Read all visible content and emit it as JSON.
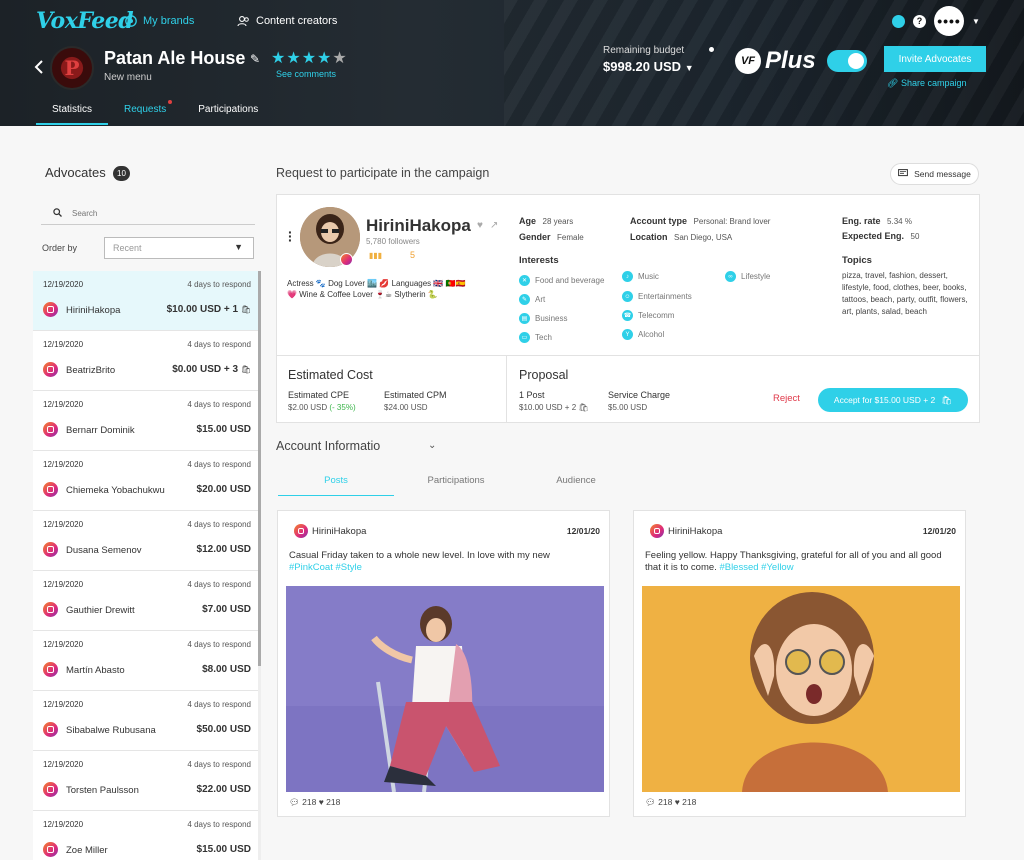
{
  "header": {
    "logo": "VoxFeed",
    "nav": [
      {
        "label": "My brands",
        "icon": "globe-icon"
      },
      {
        "label": "Content creators",
        "icon": "users-icon"
      }
    ],
    "brand": {
      "name": "Patan Ale House",
      "subtitle": "New menu",
      "logo_letter": "P",
      "rating": 4,
      "rating_max": 5,
      "see_comments": "See comments"
    },
    "budget": {
      "label": "Remaining budget",
      "value": "$998.20 USD"
    },
    "plus": {
      "badge": "VF",
      "label": "Plus",
      "enabled": true
    },
    "invite_button": "Invite Advocates",
    "share_link": "Share campaign",
    "tabs": [
      "Statistics",
      "Requests",
      "Participations"
    ],
    "active_tab": "Statistics",
    "accent_color": "#2fd0e8"
  },
  "advocates": {
    "title": "Advocates",
    "count": "10",
    "search_placeholder": "Search",
    "order_label": "Order by",
    "order_value": "Recent",
    "items": [
      {
        "date": "12/19/2020",
        "respond": "4 days to respond",
        "name": "HiriniHakopa",
        "amount": "$10.00 USD + 1",
        "selected": true
      },
      {
        "date": "12/19/2020",
        "respond": "4 days to respond",
        "name": "BeatrizBrito",
        "amount": "$0.00 USD + 3"
      },
      {
        "date": "12/19/2020",
        "respond": "4 days to respond",
        "name": "Bernarr Dominik",
        "amount": "$15.00 USD"
      },
      {
        "date": "12/19/2020",
        "respond": "4 days to respond",
        "name": "Chiemeka Yobachukwu",
        "amount": "$20.00 USD"
      },
      {
        "date": "12/19/2020",
        "respond": "4 days to respond",
        "name": "Dusana Semenov",
        "amount": "$12.00 USD"
      },
      {
        "date": "12/19/2020",
        "respond": "4 days to respond",
        "name": "Gauthier Drewitt",
        "amount": "$7.00 USD"
      },
      {
        "date": "12/19/2020",
        "respond": "4 days to respond",
        "name": "Martín Abasto",
        "amount": "$8.00 USD"
      },
      {
        "date": "12/19/2020",
        "respond": "4 days to respond",
        "name": "Sibabalwe Rubusana",
        "amount": "$50.00 USD"
      },
      {
        "date": "12/19/2020",
        "respond": "4 days to respond",
        "name": "Torsten Paulsson",
        "amount": "$22.00 USD"
      },
      {
        "date": "12/19/2020",
        "respond": "4 days to respond",
        "name": "Zoe Miller",
        "amount": "$15.00 USD"
      }
    ]
  },
  "request": {
    "title": "Request to participate in the campaign",
    "send_message": "Send message",
    "profile": {
      "name": "HiriniHakopa",
      "followers": "5,780 followers",
      "score": "5",
      "bio": "Actress 🐾 Dog Lover 🏙️ 💋 Languages 🇬🇧 🇵🇹🇪🇸 💗 Wine & Coffee Lover 🍷☕ Slytherin 🐍"
    },
    "age": {
      "label": "Age",
      "value": "28 years"
    },
    "gender": {
      "label": "Gender",
      "value": "Female"
    },
    "account_type": {
      "label": "Account type",
      "value": "Personal: Brand lover"
    },
    "location": {
      "label": "Location",
      "value": "San Diego, USA"
    },
    "eng_rate": {
      "label": "Eng. rate",
      "value": "5.34 %"
    },
    "expected_eng": {
      "label": "Expected Eng.",
      "value": "50"
    },
    "interests_label": "Interests",
    "interests": [
      "Food and beverage",
      "Music",
      "Lifestyle",
      "Art",
      "Entertainments",
      "Business",
      "Telecomm",
      "Tech",
      "Alcohol"
    ],
    "topics_label": "Topics",
    "topics": "pizza, travel, fashion, dessert, lifestyle, food, clothes, beer, books, tattoos, beach, party, outfit, flowers, art, plants, salad, beach",
    "estimated_cost": {
      "title": "Estimated Cost",
      "cpe_label": "Estimated CPE",
      "cpe_value": "$2.00 USD",
      "cpe_delta": "(- 35%)",
      "cpm_label": "Estimated CPM",
      "cpm_value": "$24.00 USD"
    },
    "proposal": {
      "title": "Proposal",
      "post_label": "1 Post",
      "post_value": "$10.00 USD + 2",
      "charge_label": "Service Charge",
      "charge_value": "$5.00 USD",
      "reject": "Reject",
      "accept": "Accept for $15.00 USD + 2"
    }
  },
  "account": {
    "title": "Account Informatio",
    "tabs": [
      "Posts",
      "Participations",
      "Audience"
    ],
    "active_tab": "Posts",
    "posts": [
      {
        "user": "HiriniHakopa",
        "date": "12/01/20",
        "caption": "Casual Friday taken to a whole new level. In love with my new",
        "tags": "#PinkCoat #Style",
        "comments": "218",
        "likes": "218"
      },
      {
        "user": "HiriniHakopa",
        "date": "12/01/20",
        "caption": "Feeling yellow. Happy Thanksgiving, grateful for all of you and all good that it is to come.",
        "tags": "#Blessed #Yellow",
        "comments": "218",
        "likes": "218"
      }
    ]
  }
}
